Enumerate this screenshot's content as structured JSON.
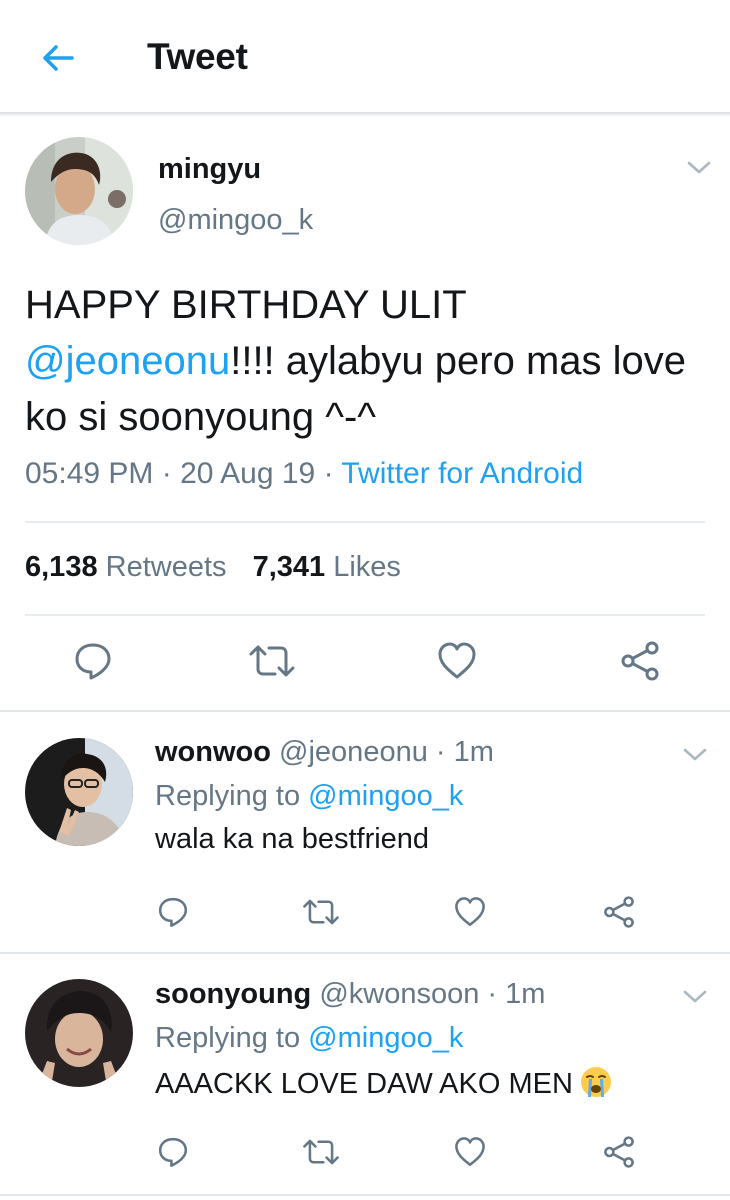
{
  "header": {
    "title": "Tweet",
    "back_icon": "arrow-left-icon",
    "accent": "#1da1f2"
  },
  "tweet": {
    "author_name": "mingyu",
    "author_handle": "@mingoo_k",
    "text_part1": "HAPPY BIRTHDAY ULIT ",
    "text_mention": "@jeoneonu",
    "text_part2": "!!!! aylabyu pero mas love ko si soonyoung ^-^",
    "time": "05:49 PM",
    "date": "20 Aug 19",
    "sep": "·",
    "source": "Twitter for Android",
    "retweets_count": "6,138",
    "retweets_label": "Retweets",
    "likes_count": "7,341",
    "likes_label": "Likes"
  },
  "replies": [
    {
      "name": "wonwoo",
      "handle": "@jeoneonu",
      "sep": "·",
      "time": "1m",
      "replying_to_label": "Replying to",
      "replying_to_handle": "@mingoo_k",
      "text": "wala ka na bestfriend"
    },
    {
      "name": "soonyoung",
      "handle": "@kwonsoon",
      "sep": "·",
      "time": "1m",
      "replying_to_label": "Replying to",
      "replying_to_handle": "@mingoo_k",
      "text": "AAACKK LOVE DAW AKO MEN",
      "emoji": "loudly-crying-face-icon"
    }
  ],
  "colors": {
    "text": "#14171a",
    "secondary": "#657786",
    "link": "#1da1f2",
    "divider": "#e6ecf0"
  }
}
